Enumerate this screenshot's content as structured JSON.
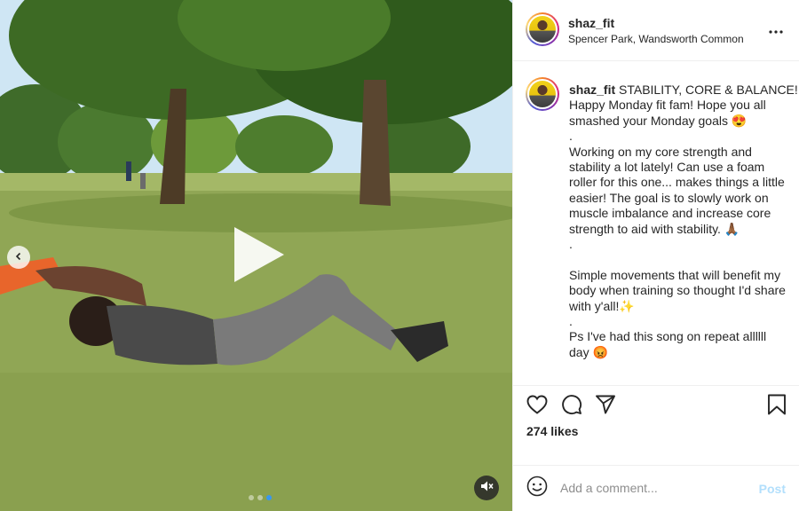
{
  "post": {
    "username": "shaz_fit",
    "location": "Spencer Park, Wandsworth Common",
    "caption_lines": [
      "STABILITY, CORE & BALANCE!",
      "Happy Monday fit fam! Hope you all",
      "smashed your Monday goals 😍",
      ".",
      "Working on my core strength and",
      "stability a lot lately! Can use a foam",
      "roller for this one... makes things a little",
      "easier! The goal is to slowly work on",
      "muscle imbalance and increase core",
      "strength to aid with stability. 🙏🏾",
      ".",
      "",
      "Simple movements that will benefit my",
      "body when training so thought I'd share",
      "with y'all!✨",
      ".",
      "Ps I've had this song on repeat allllll",
      "day 😡"
    ],
    "likes": "274 likes"
  },
  "comment": {
    "placeholder": "Add a comment...",
    "post_label": "Post"
  },
  "icons": {
    "more": "more-options-icon",
    "like": "heart-icon",
    "comment": "comment-icon",
    "share": "paper-plane-icon",
    "save": "bookmark-icon",
    "emoji": "emoji-icon",
    "play": "play-icon",
    "prev": "chevron-left-icon",
    "mute": "speaker-muted-icon"
  },
  "colors": {
    "text": "#262626",
    "muted": "#8e8e8e",
    "post_disabled": "#b2dffc",
    "dot_active": "#3897f0"
  },
  "media": {
    "dots_count": 3,
    "active_dot": 2
  }
}
